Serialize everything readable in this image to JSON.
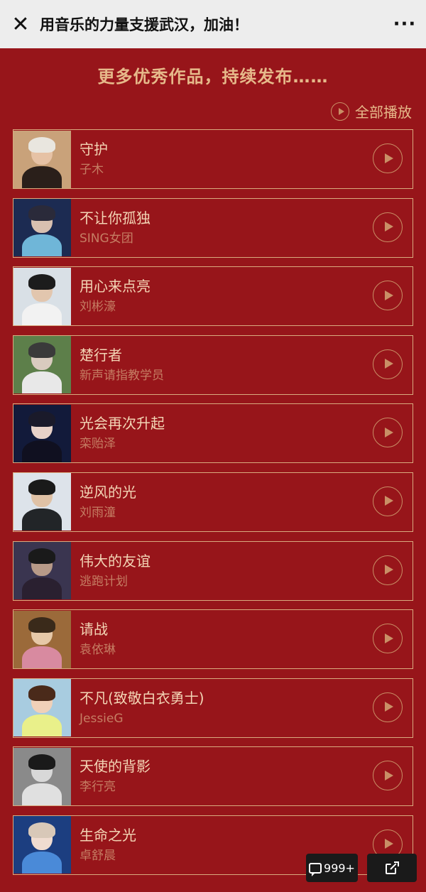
{
  "topbar": {
    "close_icon": "close-icon",
    "title": "用音乐的力量支援武汉，加油！",
    "more_icon": "more-icon",
    "more_glyph": "···"
  },
  "heading": "更多优秀作品，持续发布……",
  "play_all": {
    "label": "全部播放",
    "icon": "play-circle-icon"
  },
  "songs": [
    {
      "title": "守护",
      "artist": "子木",
      "bg": "#c9a27a",
      "hair": "#e9e6df",
      "skin": "#e6c2a5",
      "cloth": "#2a1f1a"
    },
    {
      "title": "不让你孤独",
      "artist": "SING女团",
      "bg": "#1c2b52",
      "hair": "#2a2a3a",
      "skin": "#d8c0b0",
      "cloth": "#6fb6d8"
    },
    {
      "title": "用心来点亮",
      "artist": "刘彬濠",
      "bg": "#d9e0e6",
      "hair": "#1c1c1c",
      "skin": "#e2c6ae",
      "cloth": "#f2f2f2"
    },
    {
      "title": "楚行者",
      "artist": "新声请指教学员",
      "bg": "#5d7f4a",
      "hair": "#3a3a3a",
      "skin": "#d9cbbf",
      "cloth": "#e8e8e8"
    },
    {
      "title": "光会再次升起",
      "artist": "栾贻泽",
      "bg": "#121a3a",
      "hair": "#1a1a2a",
      "skin": "#e8d2c8",
      "cloth": "#101020"
    },
    {
      "title": "逆风的光",
      "artist": "刘雨潼",
      "bg": "#dde3ea",
      "hair": "#1a1a1a",
      "skin": "#e0c2a6",
      "cloth": "#222528"
    },
    {
      "title": "伟大的友谊",
      "artist": "逃跑计划",
      "bg": "#3a3550",
      "hair": "#1a1a1a",
      "skin": "#b79a88",
      "cloth": "#2a2030"
    },
    {
      "title": "请战",
      "artist": "袁依琳",
      "bg": "#9b6a3a",
      "hair": "#3a2a1a",
      "skin": "#e6c8a8",
      "cloth": "#d88aa0"
    },
    {
      "title": "不凡(致敬白衣勇士)",
      "artist": "JessieG",
      "bg": "#a8cce0",
      "hair": "#4a2a1a",
      "skin": "#f0d0b8",
      "cloth": "#e9f08a"
    },
    {
      "title": "天使的背影",
      "artist": "李行亮",
      "bg": "#8a8a8a",
      "hair": "#1a1a1a",
      "skin": "#d8d8d8",
      "cloth": "#e0e0e0"
    },
    {
      "title": "生命之光",
      "artist": "卓舒晨",
      "bg": "#1c3e80",
      "hair": "#d8c8b8",
      "skin": "#f0dcd0",
      "cloth": "#4a8ad8"
    }
  ],
  "floating": {
    "comment_count": "999+",
    "comment_icon": "comment-bubble-icon",
    "share_icon": "share-icon"
  }
}
